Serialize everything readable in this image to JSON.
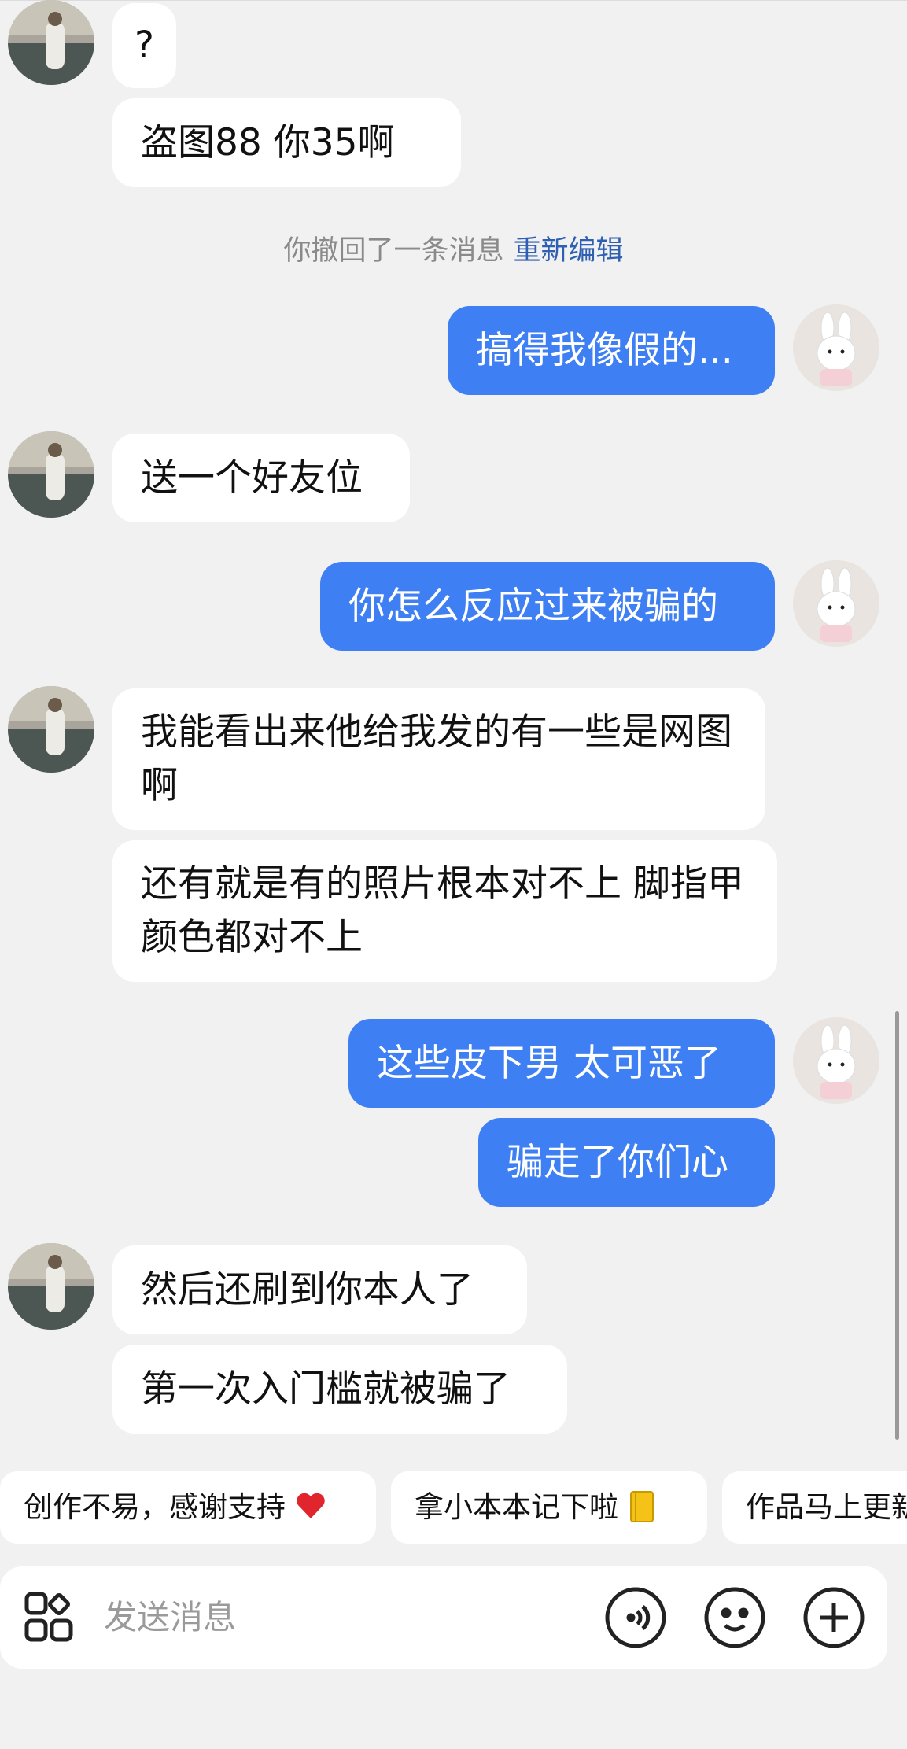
{
  "system_notice": {
    "text": "你撤回了一条消息",
    "link": "重新编辑"
  },
  "messages": [
    {
      "from": "other",
      "text": "?"
    },
    {
      "from": "other",
      "text": "盗图88  你35啊"
    },
    {
      "from": "me",
      "text": "搞得我像假的..."
    },
    {
      "from": "other",
      "text": "送一个好友位"
    },
    {
      "from": "me",
      "text": "你怎么反应过来被骗的"
    },
    {
      "from": "other",
      "text": "我能看出来他给我发的有一些是网图啊"
    },
    {
      "from": "other",
      "text": "还有就是有的照片根本对不上 脚指甲颜色都对不上"
    },
    {
      "from": "me",
      "text": "这些皮下男 太可恶了"
    },
    {
      "from": "me",
      "text": "骗走了你们心"
    },
    {
      "from": "other",
      "text": "然后还刷到你本人了"
    },
    {
      "from": "other",
      "text": "第一次入门槛就被骗了"
    }
  ],
  "quick_replies": [
    {
      "text": "创作不易，感谢支持",
      "emoji": "heart"
    },
    {
      "text": "拿小本本记下啦",
      "emoji": "notebook"
    },
    {
      "text": "作品马上更新",
      "emoji": ""
    }
  ],
  "input": {
    "placeholder": "发送消息"
  },
  "icons": [
    "apps-icon",
    "voice-icon",
    "emoji-icon",
    "plus-icon"
  ],
  "colors": {
    "my_bubble": "#3f7ff4",
    "their_bubble": "#ffffff",
    "background": "#f1f1f2",
    "link": "#2f5fb3"
  }
}
